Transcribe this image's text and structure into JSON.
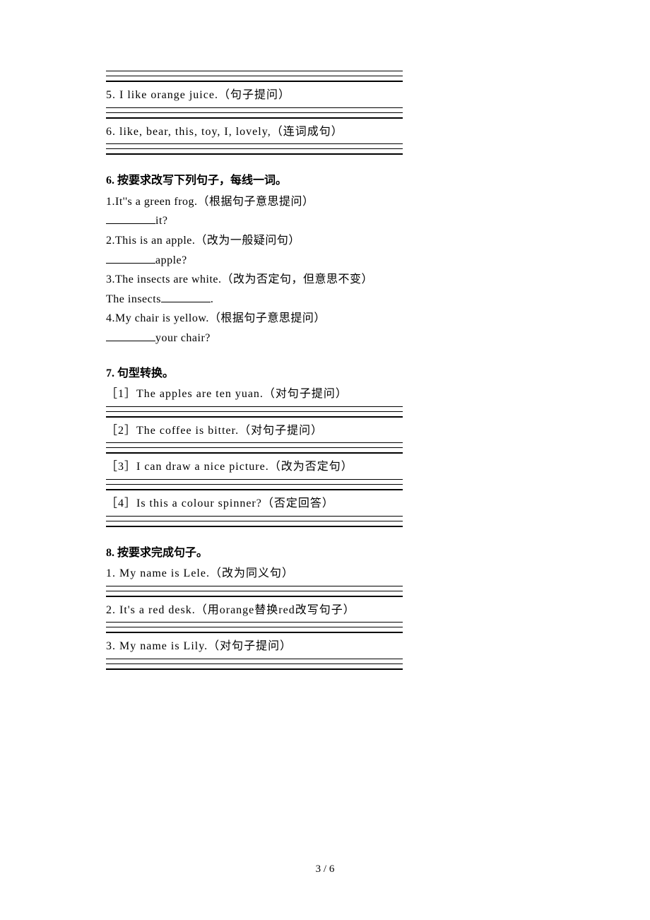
{
  "block1": {
    "q5": "5. I like orange juice.（句子提问）",
    "q6": "6. like, bear, this, toy, I, lovely,（连词成句）"
  },
  "section6": {
    "header": "6. 按要求改写下列句子，每线一词。",
    "q1a": "1.It''s a green frog.（根据句子意思提问）",
    "q1b": "it?",
    "q2a": "2.This is an apple.（改为一般疑问句）",
    "q2b": "apple?",
    "q3a": "3.The insects are white.（改为否定句，但意思不变）",
    "q3b_pre": "The insects",
    "q3b_post": ".",
    "q4a": "4.My chair is yellow.（根据句子意思提问）",
    "q4b": "your chair?"
  },
  "section7": {
    "header": "7. 句型转换。",
    "q1": "［1］The apples are ten yuan.（对句子提问）",
    "q2": "［2］The coffee is bitter.（对句子提问）",
    "q3": "［3］I can draw a nice picture.（改为否定句）",
    "q4": "［4］Is this a colour spinner?（否定回答）"
  },
  "section8": {
    "header": "8. 按要求完成句子。",
    "q1": "1. My name is Lele.（改为同义句）",
    "q2": "2. It's a red desk.（用orange替换red改写句子）",
    "q3": "3. My name is Lily.（对句子提问）"
  },
  "page": "3 / 6"
}
